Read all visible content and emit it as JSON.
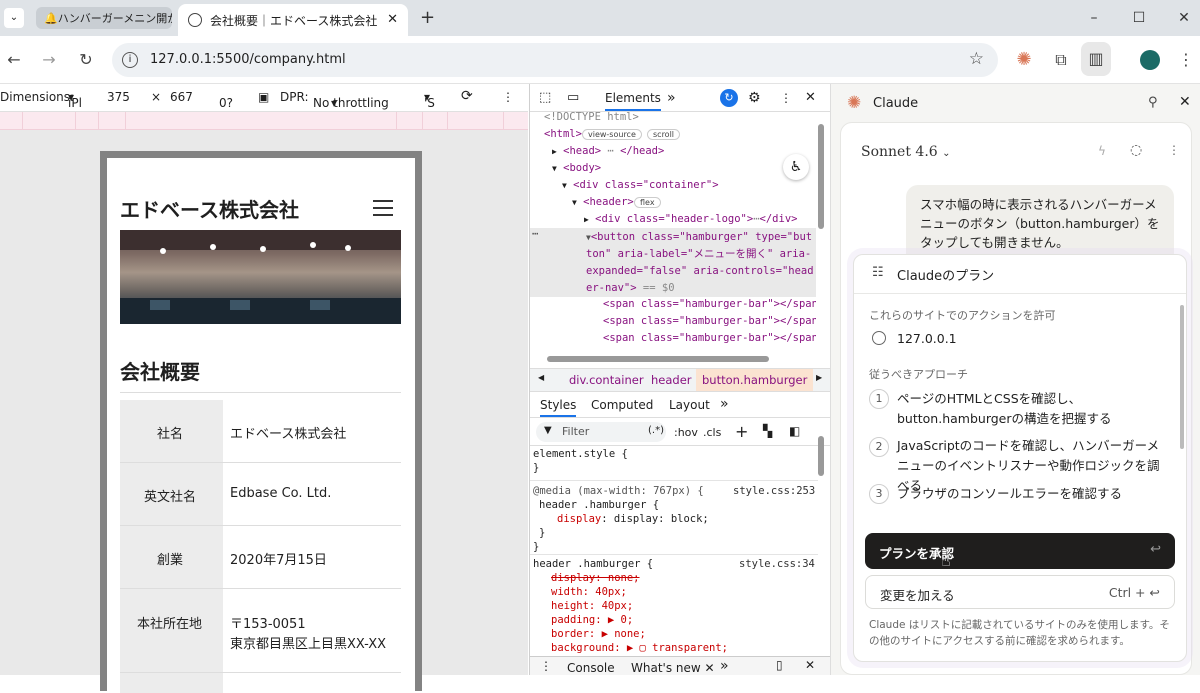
{
  "tabs": [
    {
      "label": "🔔ハンバーガーメニン開か"
    },
    {
      "label": "会社概要｜エドベース株式会社"
    }
  ],
  "address": {
    "url": "127.0.0.1:5500/company.html"
  },
  "device_toolbar": {
    "dimensions_label": "Dimensions:",
    "device": "iPl",
    "width": "375",
    "times": "×",
    "height": "667",
    "zoom": "0?",
    "dpr_label": "DPR:",
    "throttle": "No throttling",
    "save": "'S"
  },
  "site": {
    "company_name": "エドベース株式会社",
    "section_title": "会社概要",
    "table": [
      {
        "label": "社名",
        "value": "エドベース株式会社"
      },
      {
        "label": "英文社名",
        "value": "Edbase Co. Ltd."
      },
      {
        "label": "創業",
        "value": "2020年7月15日"
      },
      {
        "label": "本社所在地",
        "value": "〒153-0051",
        "value2": "東京都目黒区上目黒XX-XX"
      }
    ]
  },
  "devtools": {
    "tab_elements": "Elements",
    "more_tabs": "»",
    "dom_lines": [
      "<!DOCTYPE html>",
      "<html>",
      "<head>",
      "<body>",
      "<div class=\"container\">",
      "<header>",
      "<div class=\"header-logo\">",
      "<button class=\"hamburger\" type=\"button\" aria-label=\"メニューを開く\" aria-expanded=\"false\" aria-controls=\"header-nav\">",
      "<span class=\"hamburger-bar\"></span>"
    ],
    "badges": {
      "view_source": "view-source",
      "scroll": "scroll",
      "flex": "flex",
      "eq": "== $0"
    },
    "breadcrumbs": [
      "div.container",
      "header",
      "button.hamburger"
    ],
    "styles_tabs": [
      "Styles",
      "Computed",
      "Layout"
    ],
    "filter_placeholder": "Filter",
    "filter_tools": [
      ":hov",
      ".cls"
    ],
    "rules": {
      "element_style": "element.style {",
      "media": "@media (max-width: 767px) {",
      "media_src": "style.css:253",
      "selector": "header .hamburger {",
      "display_block": "display: block;",
      "rule2_selector": "header .hamburger {",
      "rule2_src": "style.css:34",
      "props": [
        "display: none;",
        "width: 40px;",
        "height: 40px;",
        "padding: ▶ 0;",
        "border: ▶ none;",
        "background: ▶ ▢ transparent;"
      ]
    },
    "drawer_tabs": [
      "Console",
      "What's new"
    ]
  },
  "claude": {
    "title": "Claude",
    "model": "Sonnet 4.6",
    "user_message": "スマホ幅の時に表示されるハンバーガーメニューのボタン（button.hamburger）をタップしても開きません。",
    "plan_title": "Claudeのプラン",
    "allow_label": "これらのサイトでのアクションを許可",
    "site": "127.0.0.1",
    "approach_label": "従うべきアプローチ",
    "steps": [
      {
        "num": "1",
        "text": "ページのHTMLとCSSを確認し、button.hamburgerの構造を把握する"
      },
      {
        "num": "2",
        "text": "JavaScriptのコードを確認し、ハンバーガーメニューのイベントリスナーや動作ロジックを調べる"
      },
      {
        "num": "3",
        "text": "ブラウザのコンソールエラーを確認する"
      }
    ],
    "approve_button": "プランを承認",
    "change_button": "変更を加える",
    "change_shortcut": "Ctrl +",
    "footer": "Claude はリストに記載されているサイトのみを使用します。その他のサイトにアクセスする前に確認を求められます。"
  },
  "colors": {
    "accent": "#d97757",
    "devtools_blue": "#1a73e8",
    "approve_bg": "#1f1e1d"
  }
}
